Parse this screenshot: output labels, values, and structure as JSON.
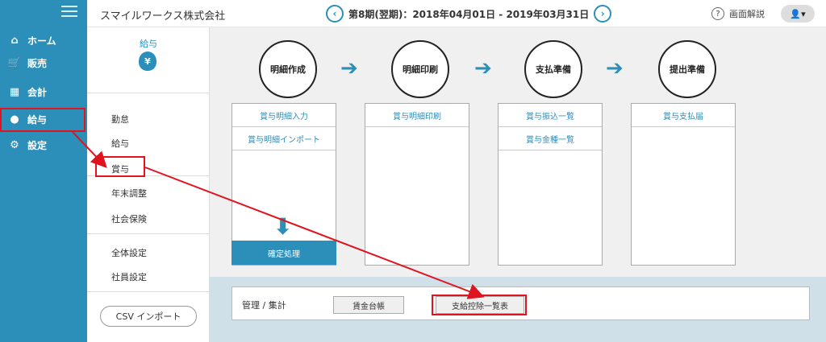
{
  "sidebar": {
    "items": [
      {
        "icon": "home-icon",
        "label": "ホーム"
      },
      {
        "icon": "cart-icon",
        "label": "販売"
      },
      {
        "icon": "calculator-icon",
        "label": "会計"
      },
      {
        "icon": "moneybag-icon",
        "label": "給与"
      },
      {
        "icon": "gear-icon",
        "label": "設定"
      }
    ]
  },
  "header": {
    "company": "スマイルワークス株式会社",
    "period": "第8期(翌期)：2018年04月01日 - 2019年03月31日",
    "help_label": "画面解説",
    "user_caret": "▾"
  },
  "subpanel": {
    "title": "給与",
    "badge": "¥",
    "items": [
      "勤怠",
      "給与",
      "賞与",
      "年末調整",
      "社会保険",
      "全体設定",
      "社員設定"
    ],
    "csv_button": "CSV インポート"
  },
  "workflow": {
    "steps": [
      "明細作成",
      "明細印刷",
      "支払準備",
      "提出準備"
    ],
    "columns": [
      [
        "賞与明細入力",
        "賞与明細インポート"
      ],
      [
        "賞与明細印刷"
      ],
      [
        "賞与振込一覧",
        "賞与金種一覧"
      ],
      [
        "賞与支払届"
      ]
    ],
    "confirm_button": "確定処理"
  },
  "management": {
    "label": "管理 / 集計",
    "buttons": [
      "賃金台帳",
      "支給控除一覧表"
    ]
  },
  "colors": {
    "accent": "#2b8fba",
    "highlight": "#e0141e"
  }
}
